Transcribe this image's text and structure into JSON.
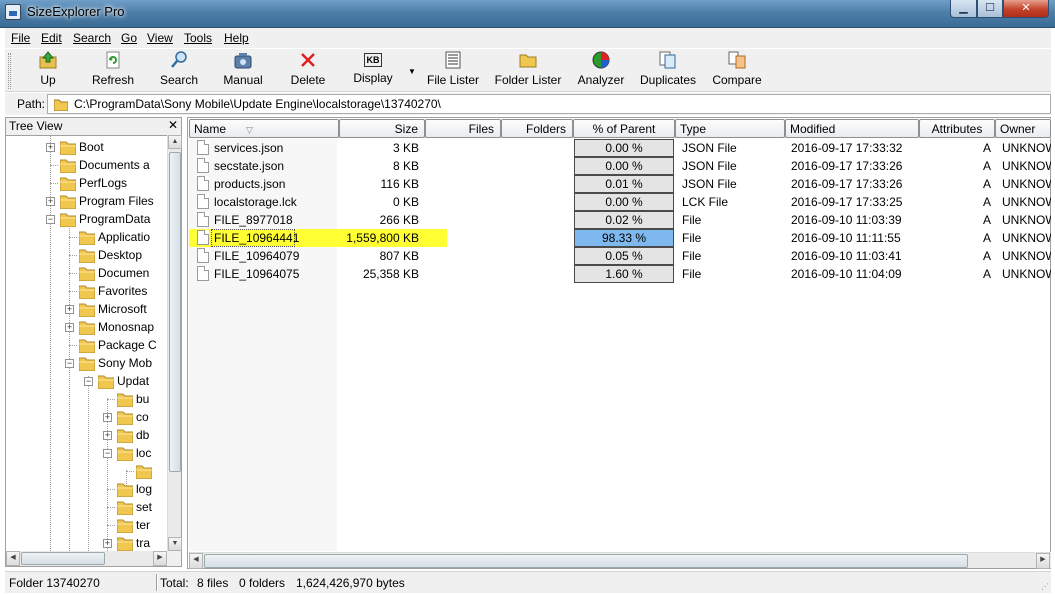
{
  "window": {
    "title": "SizeExplorer Pro"
  },
  "menu": [
    "File",
    "Edit",
    "Search",
    "Go",
    "View",
    "Tools",
    "Help"
  ],
  "toolbar": {
    "up": "Up",
    "refresh": "Refresh",
    "search": "Search",
    "manual": "Manual",
    "delete": "Delete",
    "display": "Display",
    "display_icon_text": "KB",
    "file_lister": "File Lister",
    "folder_lister": "Folder Lister",
    "analyzer": "Analyzer",
    "duplicates": "Duplicates",
    "compare": "Compare"
  },
  "pathbar": {
    "label": "Path:",
    "value": "C:\\ProgramData\\Sony Mobile\\Update Engine\\localstorage\\13740270\\"
  },
  "tree": {
    "title": "Tree View",
    "close": "✕",
    "nodes": [
      {
        "label": "Boot"
      },
      {
        "label": "Documents a"
      },
      {
        "label": "PerfLogs"
      },
      {
        "label": "Program Files"
      },
      {
        "label": "ProgramData"
      },
      {
        "label": "Applicatio"
      },
      {
        "label": "Desktop"
      },
      {
        "label": "Documen"
      },
      {
        "label": "Favorites"
      },
      {
        "label": "Microsoft"
      },
      {
        "label": "Monosnap"
      },
      {
        "label": "Package C"
      },
      {
        "label": "Sony Mob"
      },
      {
        "label": "Updat"
      },
      {
        "label": "bu"
      },
      {
        "label": "co"
      },
      {
        "label": "db"
      },
      {
        "label": "loc"
      },
      {
        "label": ""
      },
      {
        "label": "log"
      },
      {
        "label": "set"
      },
      {
        "label": "ter"
      },
      {
        "label": "tra"
      }
    ]
  },
  "columns": {
    "name": "Name",
    "size": "Size",
    "files": "Files",
    "folders": "Folders",
    "pct": "% of Parent",
    "type": "Type",
    "modified": "Modified",
    "attributes": "Attributes",
    "owner": "Owner"
  },
  "files": [
    {
      "name": "services.json",
      "size": "3 KB",
      "pct": "0.00 %",
      "type": "JSON File",
      "modified": "2016-09-17 17:33:32",
      "attr": "A",
      "owner": "UNKNOW"
    },
    {
      "name": "secstate.json",
      "size": "8 KB",
      "pct": "0.00 %",
      "type": "JSON File",
      "modified": "2016-09-17 17:33:26",
      "attr": "A",
      "owner": "UNKNOW"
    },
    {
      "name": "products.json",
      "size": "116 KB",
      "pct": "0.01 %",
      "type": "JSON File",
      "modified": "2016-09-17 17:33:26",
      "attr": "A",
      "owner": "UNKNOW"
    },
    {
      "name": "localstorage.lck",
      "size": "0 KB",
      "pct": "0.00 %",
      "type": "LCK File",
      "modified": "2016-09-17 17:33:25",
      "attr": "A",
      "owner": "UNKNOW"
    },
    {
      "name": "FILE_8977018",
      "size": "266 KB",
      "pct": "0.02 %",
      "type": "File",
      "modified": "2016-09-10 11:03:39",
      "attr": "A",
      "owner": "UNKNOW"
    },
    {
      "name": "FILE_10964441",
      "size": "1,559,800 KB",
      "pct": "98.33 %",
      "type": "File",
      "modified": "2016-09-10 11:11:55",
      "attr": "A",
      "owner": "UNKNOW"
    },
    {
      "name": "FILE_10964079",
      "size": "807 KB",
      "pct": "0.05 %",
      "type": "File",
      "modified": "2016-09-10 11:03:41",
      "attr": "A",
      "owner": "UNKNOW"
    },
    {
      "name": "FILE_10964075",
      "size": "25,358 KB",
      "pct": "1.60 %",
      "type": "File",
      "modified": "2016-09-10 11:04:09",
      "attr": "A",
      "owner": "UNKNOW"
    }
  ],
  "status": {
    "folder": "Folder 13740270",
    "total_label": "Total:",
    "files": "8 files",
    "folders": "0 folders",
    "bytes": "1,624,426,970 bytes"
  },
  "colors": {
    "selection_highlight": "#ffff33",
    "selected_pct": "#7fb8ee"
  }
}
